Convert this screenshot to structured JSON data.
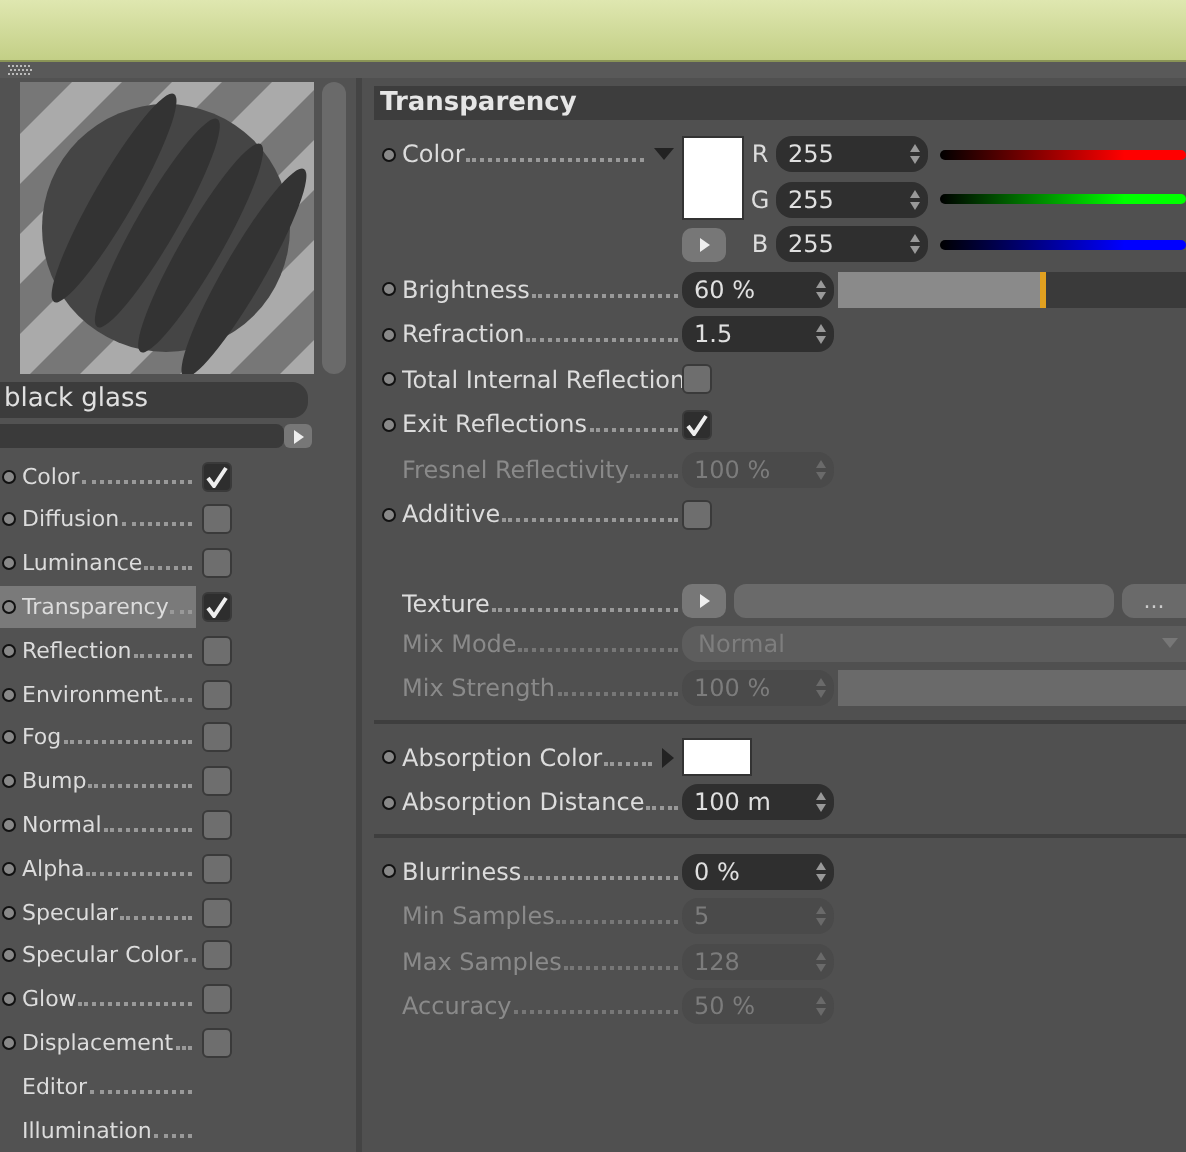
{
  "material": {
    "name": "black glass"
  },
  "channels": [
    {
      "name": "Color",
      "kind": "toggle",
      "checked": true,
      "selected": false
    },
    {
      "name": "Diffusion",
      "kind": "toggle",
      "checked": false,
      "selected": false
    },
    {
      "name": "Luminance",
      "kind": "toggle",
      "checked": false,
      "selected": false
    },
    {
      "name": "Transparency",
      "kind": "toggle",
      "checked": true,
      "selected": true
    },
    {
      "name": "Reflection",
      "kind": "toggle",
      "checked": false,
      "selected": false
    },
    {
      "name": "Environment",
      "kind": "toggle",
      "checked": false,
      "selected": false
    },
    {
      "name": "Fog",
      "kind": "toggle",
      "checked": false,
      "selected": false
    },
    {
      "name": "Bump",
      "kind": "toggle",
      "checked": false,
      "selected": false
    },
    {
      "name": "Normal",
      "kind": "toggle",
      "checked": false,
      "selected": false
    },
    {
      "name": "Alpha",
      "kind": "toggle",
      "checked": false,
      "selected": false
    },
    {
      "name": "Specular",
      "kind": "toggle",
      "checked": false,
      "selected": false
    },
    {
      "name": "Specular Color",
      "kind": "toggle",
      "checked": false,
      "selected": false
    },
    {
      "name": "Glow",
      "kind": "toggle",
      "checked": false,
      "selected": false
    },
    {
      "name": "Displacement",
      "kind": "toggle",
      "checked": false,
      "selected": false
    },
    {
      "name": "Editor",
      "kind": "plain",
      "selected": false
    },
    {
      "name": "Illumination",
      "kind": "plain",
      "selected": false
    }
  ],
  "panel": {
    "title": "Transparency",
    "groups": [
      {
        "rows": [
          {
            "kind": "color",
            "label": "Color",
            "dot": true,
            "disabled": false,
            "expanded": true,
            "color": "#ffffff",
            "channels": [
              {
                "name": "R",
                "value": "255",
                "color": "#ff0000"
              },
              {
                "name": "G",
                "value": "255",
                "color": "#00ff00"
              },
              {
                "name": "B",
                "value": "255",
                "color": "#0000ff"
              }
            ]
          },
          {
            "kind": "number",
            "label": "Brightness",
            "dot": true,
            "disabled": false,
            "value": "60 %",
            "level": 0.6
          },
          {
            "kind": "number",
            "label": "Refraction",
            "dot": true,
            "disabled": false,
            "value": "1.5"
          },
          {
            "kind": "checkbox",
            "label": "Total Internal Reflection",
            "dot": true,
            "disabled": false,
            "checked": false
          },
          {
            "kind": "checkbox",
            "label": "Exit Reflections",
            "dot": true,
            "disabled": false,
            "checked": true
          },
          {
            "kind": "number",
            "label": "Fresnel Reflectivity",
            "dot": false,
            "disabled": true,
            "value": "100 %"
          },
          {
            "kind": "checkbox",
            "label": "Additive",
            "dot": true,
            "disabled": false,
            "checked": false
          }
        ]
      },
      {
        "rows": [
          {
            "kind": "texture",
            "label": "Texture",
            "dot": false,
            "disabled": false,
            "browse": "..."
          },
          {
            "kind": "dropdown",
            "label": "Mix Mode",
            "dot": false,
            "disabled": true,
            "value": "Normal"
          },
          {
            "kind": "number",
            "label": "Mix Strength",
            "dot": false,
            "disabled": true,
            "value": "100 %",
            "slider": true
          }
        ]
      },
      {
        "rows": [
          {
            "kind": "swatch",
            "label": "Absorption Color",
            "dot": true,
            "disabled": false,
            "expanded": false,
            "color": "#ffffff"
          },
          {
            "kind": "number",
            "label": "Absorption Distance",
            "dot": true,
            "disabled": false,
            "value": "100 m"
          }
        ]
      },
      {
        "rows": [
          {
            "kind": "number",
            "label": "Blurriness",
            "dot": true,
            "disabled": false,
            "value": "0 %"
          },
          {
            "kind": "number",
            "label": "Min Samples",
            "dot": false,
            "disabled": true,
            "value": "5"
          },
          {
            "kind": "number",
            "label": "Max Samples",
            "dot": false,
            "disabled": true,
            "value": "128"
          },
          {
            "kind": "number",
            "label": "Accuracy",
            "dot": false,
            "disabled": true,
            "value": "50 %"
          }
        ]
      }
    ]
  }
}
